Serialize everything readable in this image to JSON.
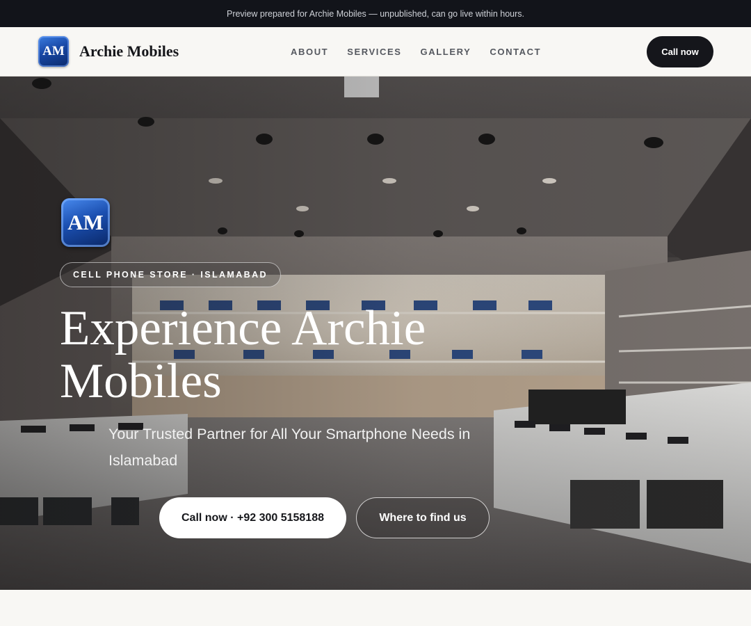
{
  "preview_bar": {
    "text": "Preview prepared for Archie Mobiles — unpublished, can go live within hours."
  },
  "header": {
    "logo_text": "AM",
    "brand_name": "Archie Mobiles",
    "nav": [
      {
        "label": "ABOUT"
      },
      {
        "label": "SERVICES"
      },
      {
        "label": "GALLERY"
      },
      {
        "label": "CONTACT"
      }
    ],
    "call_button": "Call now"
  },
  "hero": {
    "logo_text": "AM",
    "eyebrow": "CELL PHONE STORE · ISLAMABAD",
    "title": "Experience Archie Mobiles",
    "subtitle": "Your Trusted Partner for All Your Smartphone Needs in Islamabad",
    "primary_button": "Call now · +92 300 5158188",
    "secondary_button": "Where to find us",
    "background_image": "cell-phone-store-interior"
  },
  "colors": {
    "preview_bar_bg": "#12141a",
    "header_bg": "#f8f7f4",
    "call_button_bg": "#15161b",
    "logo_blue": "#1848a6"
  }
}
